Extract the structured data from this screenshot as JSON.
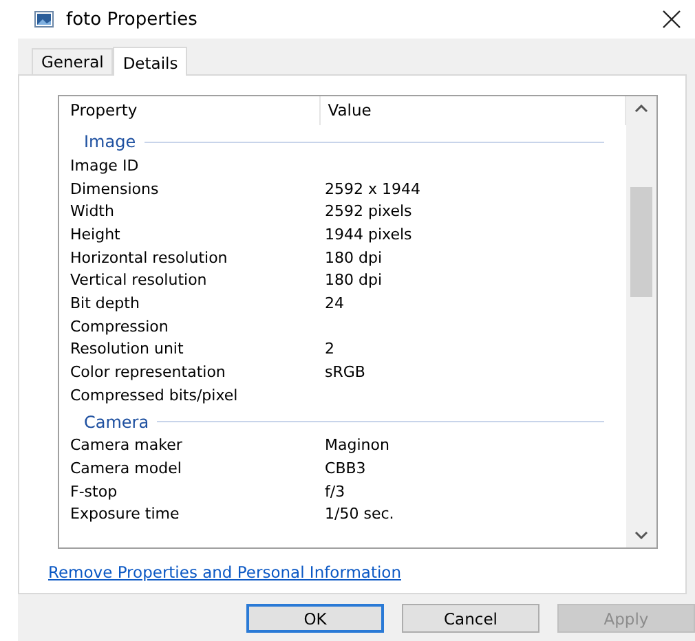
{
  "window": {
    "title": "foto Properties"
  },
  "tabs": [
    {
      "label": "General",
      "selected": false
    },
    {
      "label": "Details",
      "selected": true
    }
  ],
  "table": {
    "columns": [
      "Property",
      "Value"
    ],
    "groups": [
      {
        "title": "Image",
        "rows": [
          {
            "property": "Image ID",
            "value": ""
          },
          {
            "property": "Dimensions",
            "value": "2592 x 1944"
          },
          {
            "property": "Width",
            "value": "2592 pixels"
          },
          {
            "property": "Height",
            "value": "1944 pixels"
          },
          {
            "property": "Horizontal resolution",
            "value": "180 dpi"
          },
          {
            "property": "Vertical resolution",
            "value": "180 dpi"
          },
          {
            "property": "Bit depth",
            "value": "24"
          },
          {
            "property": "Compression",
            "value": ""
          },
          {
            "property": "Resolution unit",
            "value": "2"
          },
          {
            "property": "Color representation",
            "value": "sRGB"
          },
          {
            "property": "Compressed bits/pixel",
            "value": ""
          }
        ]
      },
      {
        "title": "Camera",
        "rows": [
          {
            "property": "Camera maker",
            "value": "Maginon"
          },
          {
            "property": "Camera model",
            "value": "CBB3"
          },
          {
            "property": "F-stop",
            "value": "f/3"
          },
          {
            "property": "Exposure time",
            "value": "1/50 sec."
          }
        ]
      }
    ]
  },
  "link": "Remove Properties and Personal Information",
  "buttons": [
    {
      "label": "OK",
      "default": true,
      "disabled": false
    },
    {
      "label": "Cancel",
      "default": false,
      "disabled": false
    },
    {
      "label": "Apply",
      "default": false,
      "disabled": true
    }
  ]
}
